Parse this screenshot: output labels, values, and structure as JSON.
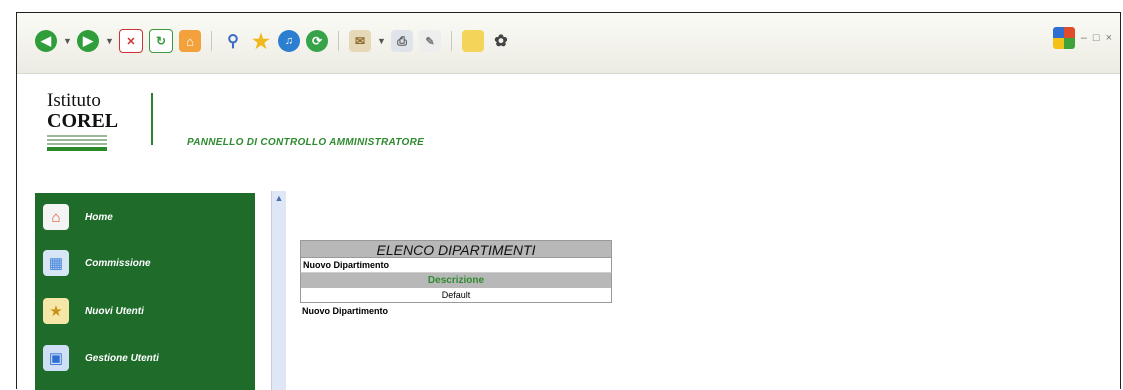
{
  "toolbar": {
    "icons": [
      "back-icon",
      "forward-icon",
      "stop-icon",
      "refresh-icon",
      "home-icon",
      "search-icon",
      "favorites-icon",
      "media-icon",
      "history-icon",
      "mail-icon",
      "print-icon",
      "edit-icon",
      "folder-icon",
      "settings-icon"
    ],
    "window_controls": [
      "windows-flag-icon",
      "minimize-icon",
      "maximize-icon",
      "close-icon"
    ]
  },
  "header": {
    "logo_line1": "Istituto",
    "logo_line2": "COREL",
    "title": "PANNELLO DI CONTROLLO AMMINISTRATORE"
  },
  "sidebar": {
    "items": [
      {
        "label": "Home",
        "icon": "home-icon",
        "color": "#d9532c"
      },
      {
        "label": "Commissione",
        "icon": "network-icon",
        "color": "#3b7dd8"
      },
      {
        "label": "Nuovi Utenti",
        "icon": "new-user-icon",
        "color": "#f0c02a"
      },
      {
        "label": "Gestione Utenti",
        "icon": "users-icon",
        "color": "#4a86d9"
      }
    ]
  },
  "panel": {
    "title": "ELENCO DIPARTIMENTI",
    "new_link": "Nuovo Dipartimento",
    "column_header": "Descrizione",
    "rows": [
      "Default"
    ],
    "new_link_bottom": "Nuovo Dipartimento"
  },
  "colors": {
    "sidebar_bg": "#1e6b2a",
    "accent_green": "#2f8a2f",
    "panel_header_bg": "#b8b8b8"
  }
}
